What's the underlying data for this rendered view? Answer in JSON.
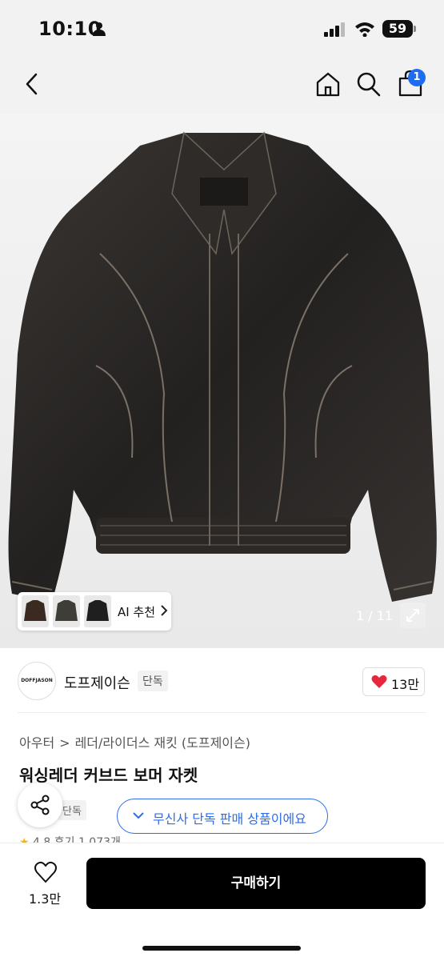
{
  "status_bar": {
    "time": "10:10",
    "battery": "59"
  },
  "cart": {
    "badge_count": "1"
  },
  "gallery": {
    "counter": "1 / 11",
    "ai_recommend_label": "AI 추천"
  },
  "brand": {
    "logo_text": "DOFFJASON",
    "name": "도프제이슨",
    "tag": "단독",
    "like_count": "13만"
  },
  "breadcrumb": {
    "items": [
      "아우터",
      "레더/라이더스 재킷 (도프제이슨)"
    ]
  },
  "product": {
    "title": "워싱레더 커브드 보머 자켓",
    "tag": "단독",
    "rating": "4.8",
    "review_text": "후기 1,073개"
  },
  "exclusive_pill": {
    "label": "무신사 단독 판매 상품이에요"
  },
  "bottom_bar": {
    "wishlist_count": "1.3만",
    "buy_label": "구매하기"
  },
  "colors": {
    "accent": "#2f6de8",
    "cart_badge": "#1e6cf0",
    "heart": "#e5283e"
  }
}
